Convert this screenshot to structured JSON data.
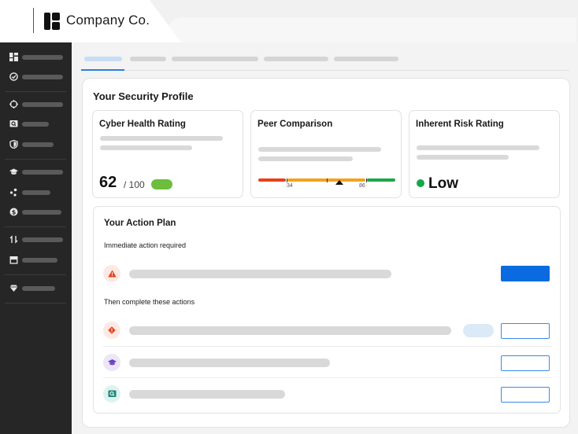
{
  "app": {
    "company_name": "Company Co."
  },
  "sidebar": {
    "items": [
      {
        "icon": "dashboard-icon"
      },
      {
        "icon": "check-circle-icon"
      },
      {
        "icon": "target-icon"
      },
      {
        "icon": "search-screen-icon"
      },
      {
        "icon": "shield-icon"
      },
      {
        "icon": "graduation-cap-icon"
      },
      {
        "icon": "nodes-icon"
      },
      {
        "icon": "dollar-icon"
      },
      {
        "icon": "transfer-icon"
      },
      {
        "icon": "store-icon"
      },
      {
        "icon": "diamond-icon"
      }
    ]
  },
  "profile": {
    "title": "Your Security Profile",
    "cyber_health": {
      "title": "Cyber Health Rating",
      "score": "62",
      "denominator": "/ 100",
      "status_color": "#6cbe3c"
    },
    "peer_comparison": {
      "title": "Peer Comparison",
      "low_marker": "34",
      "high_marker": "86",
      "segment_colors": [
        "#e8401c",
        "#f2a21e",
        "#1fa64a"
      ]
    },
    "inherent_risk": {
      "title": "Inherent Risk Rating",
      "level": "Low",
      "level_color": "#17a44a"
    }
  },
  "action_plan": {
    "title": "Your Action Plan",
    "immediate_label": "Immediate action required",
    "then_label": "Then complete these actions",
    "rows": [
      {
        "icon": "warning-icon",
        "icon_color": "#e8401c"
      },
      {
        "icon": "alert-diamond-icon",
        "icon_color": "#e8401c"
      },
      {
        "icon": "graduation-cap-icon",
        "icon_color": "#6b3fc4"
      },
      {
        "icon": "search-screen-icon",
        "icon_color": "#1b8a7a"
      }
    ]
  },
  "colors": {
    "accent": "#0a6be0",
    "sidebar_bg": "#262626"
  }
}
